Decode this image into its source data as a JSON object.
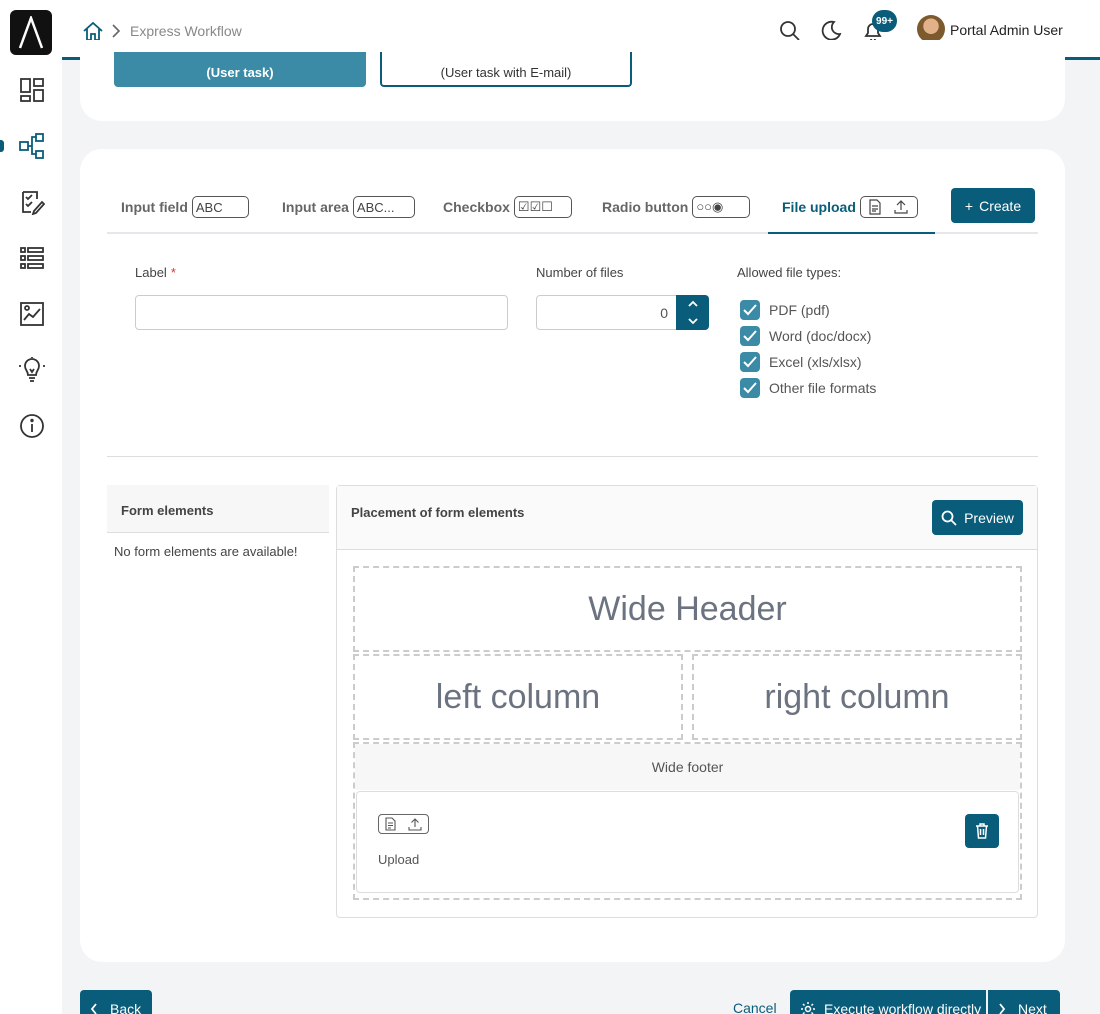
{
  "breadcrumb": {
    "current": "Express Workflow"
  },
  "topbar": {
    "notification_badge": "99+",
    "user_name": "Portal Admin User"
  },
  "sidebar": {
    "items": [
      {
        "icon": "dashboard-icon"
      },
      {
        "icon": "workflow-icon",
        "active": true
      },
      {
        "icon": "task-check-icon"
      },
      {
        "icon": "list-icon"
      },
      {
        "icon": "report-chart-icon"
      },
      {
        "icon": "lightbulb-icon"
      },
      {
        "icon": "info-icon"
      }
    ]
  },
  "top_card": {
    "button1": "(User task)",
    "button2": "(User task with E-mail)"
  },
  "tabs": [
    {
      "label": "Input field",
      "box": "ABC"
    },
    {
      "label": "Input area",
      "box": "ABC..."
    },
    {
      "label": "Checkbox",
      "box": "☑☑☐"
    },
    {
      "label": "Radio button",
      "box": "○○◉"
    },
    {
      "label": "File upload",
      "box": "",
      "active": true
    }
  ],
  "create_label": "Create",
  "form": {
    "label_label": "Label",
    "required_mark": "*",
    "label_value": "",
    "num_files_label": "Number of files",
    "num_files_value": "0",
    "allowed_label": "Allowed file types:",
    "file_types": [
      {
        "label": "PDF (pdf)",
        "checked": true
      },
      {
        "label": "Word (doc/docx)",
        "checked": true
      },
      {
        "label": "Excel (xls/xlsx)",
        "checked": true
      },
      {
        "label": "Other file formats",
        "checked": true
      }
    ]
  },
  "form_elements": {
    "title": "Form elements",
    "empty": "No form elements are available!"
  },
  "placement": {
    "title": "Placement of form elements",
    "preview_label": "Preview",
    "wide_header": "Wide Header",
    "left_column": "left column",
    "right_column": "right column",
    "wide_footer": "Wide footer",
    "upload_label": "Upload"
  },
  "footer": {
    "back_label": "Back",
    "cancel_label": "Cancel",
    "execute_label": "Execute workflow directly",
    "next_label": "Next"
  },
  "colors": {
    "accent": "#0a5d7a",
    "accent_light": "#3b8aa6"
  }
}
